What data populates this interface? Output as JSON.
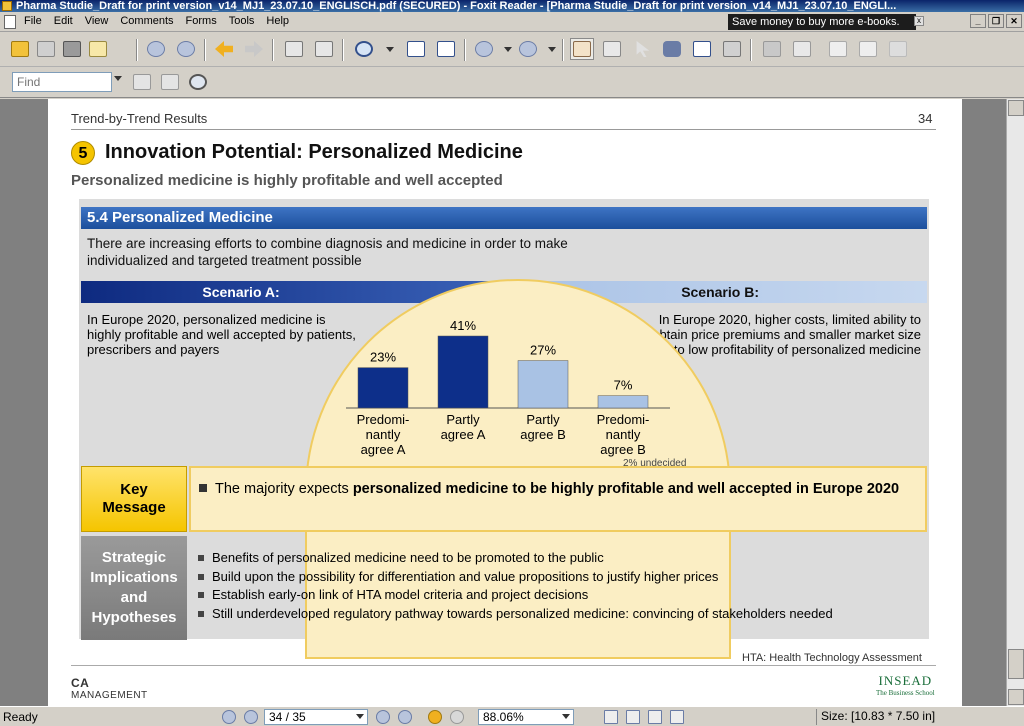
{
  "window": {
    "title": "Pharma Studie_Draft for print version_v14_MJ1_23.07.10_ENGLISCH.pdf (SECURED) - Foxit Reader - [Pharma Studie_Draft for print version_v14_MJ1_23.07.10_ENGLI..."
  },
  "menu": {
    "items": [
      "File",
      "Edit",
      "View",
      "Comments",
      "Forms",
      "Tools",
      "Help"
    ],
    "ad_text": "Save money to buy more e-books.",
    "ad_close": "x"
  },
  "toolbar": {
    "find_placeholder": "Find"
  },
  "page": {
    "running_header": "Trend-by-Trend Results",
    "page_number": "34",
    "trend_number": "5",
    "title": "Innovation Potential: Personalized Medicine",
    "subtitle": "Personalized medicine is highly profitable and well accepted",
    "section_heading": "5.4 Personalized Medicine",
    "section_text": "There are increasing efforts to combine diagnosis and medicine in order to make individualized and targeted treatment possible",
    "scenario_a_label": "Scenario A:",
    "scenario_b_label": "Scenario B:",
    "scenario_a_text": "In Europe 2020, personalized medicine is highly profitable and well accepted by patients, prescribers and payers",
    "scenario_b_text": "In Europe 2020, higher costs, limited ability to obtain price premiums and smaller market size lead to low profitability of personalized medicine",
    "undecided_note": "2% undecided",
    "key_message_label_1": "Key",
    "key_message_label_2": "Message",
    "key_message_plain": "The majority expects ",
    "key_message_bold": "personalized medicine to be highly profitable and well accepted in Europe 2020",
    "strategic_label_1": "Strategic",
    "strategic_label_2": "Implications",
    "strategic_label_3": "and",
    "strategic_label_4": "Hypotheses",
    "implications": [
      "Benefits of personalized medicine need to be promoted to the public",
      "Build upon the possibility for differentiation and value propositions to justify higher prices",
      "Establish early-on link of HTA model criteria and project decisions",
      "Still underdeveloped regulatory pathway towards personalized medicine: convincing of stakeholders needed"
    ],
    "footnote": "HTA: Health Technology Assessment",
    "logo_left_mark": "CA",
    "logo_left_text": "MANAGEMENT",
    "logo_right_text": "INSEAD",
    "logo_right_tag": "The Business School"
  },
  "chart_data": {
    "type": "bar",
    "categories": [
      "Predomi-nantly agree A",
      "Partly agree A",
      "Partly agree B",
      "Predomi-nantly agree B"
    ],
    "category_lines": [
      [
        "Predomi-",
        "nantly",
        "agree A"
      ],
      [
        "Partly",
        "agree A"
      ],
      [
        "Partly",
        "agree B"
      ],
      [
        "Predomi-",
        "nantly",
        "agree B"
      ]
    ],
    "values": [
      23,
      41,
      27,
      7
    ],
    "value_labels": [
      "23%",
      "41%",
      "27%",
      "7%"
    ],
    "colors": [
      "#0d2f8a",
      "#0d2f8a",
      "#a9c2e4",
      "#a9c2e4"
    ],
    "ylim": [
      0,
      45
    ]
  },
  "statusbar": {
    "ready": "Ready",
    "page_field": "34 / 35",
    "zoom": "88.06%",
    "size": "Size: [10.83 * 7.50 in]"
  }
}
